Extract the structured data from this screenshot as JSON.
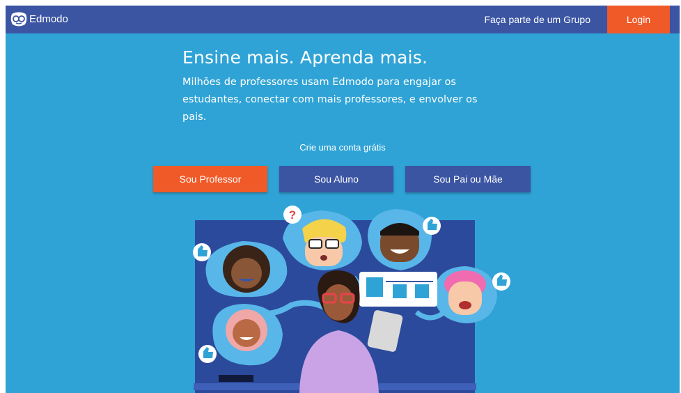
{
  "header": {
    "brand": "Edmodo",
    "join_group": "Faça parte de um Grupo",
    "login": "Login"
  },
  "hero": {
    "headline": "Ensine mais. Aprenda mais.",
    "description": "Milhões de professores usam Edmodo para engajar os estudantes, conectar com mais professores, e envolver os pais.",
    "signup_prompt": "Crie uma conta grátis"
  },
  "buttons": {
    "teacher": "Sou Professor",
    "student": "Sou Aluno",
    "parent": "Sou Pai ou Mãe"
  },
  "illustration": {
    "question_mark": "?"
  },
  "colors": {
    "page_background": "#2fa3d6",
    "header_background": "#3b55a3",
    "accent": "#f05a28",
    "secondary_button": "#3b55a3"
  },
  "icons": [
    "edmodo-logo-icon",
    "thumbs-up-icon",
    "question-icon"
  ]
}
